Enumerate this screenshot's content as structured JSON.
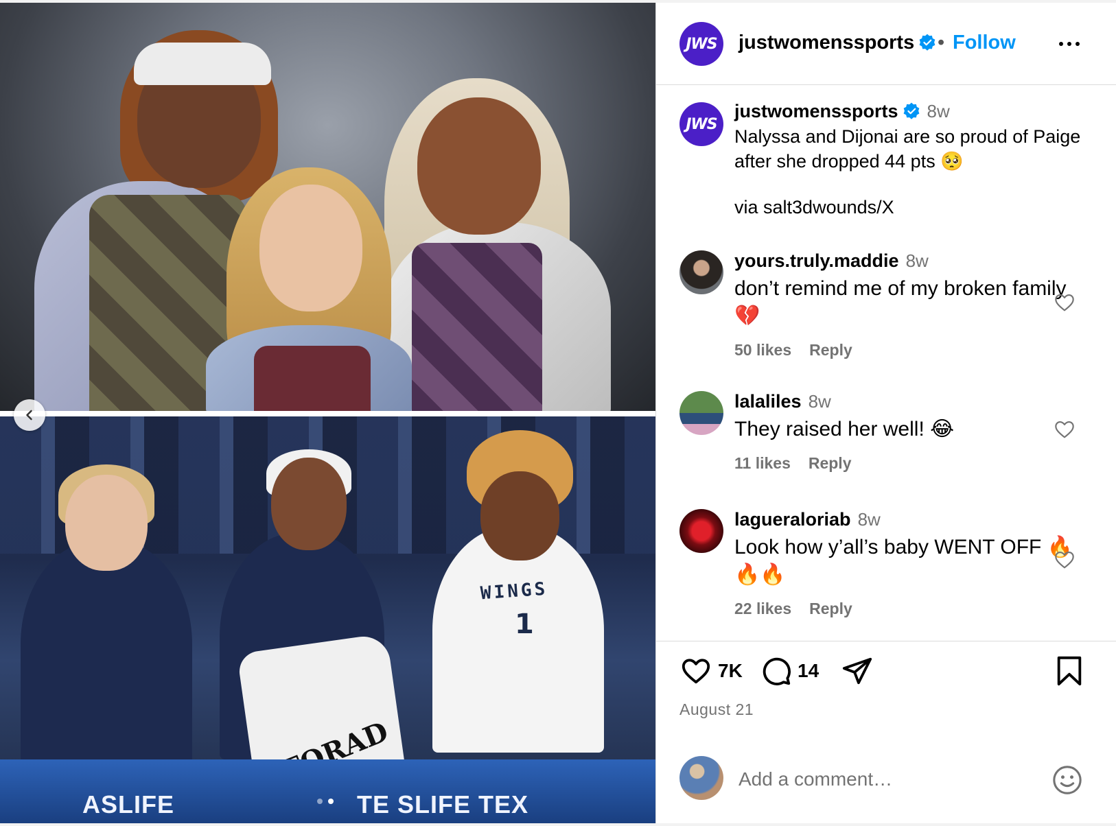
{
  "post": {
    "header": {
      "avatar_text": "JWS",
      "username": "justwomenssports",
      "separator": "•",
      "follow_label": "Follow"
    },
    "caption": {
      "avatar_text": "JWS",
      "username": "justwomenssports",
      "time": "8w",
      "text": "Nalyssa and Dijonai are so proud of Paige after she dropped 44 pts 🥺",
      "via": "via salt3dwounds/X"
    },
    "comments": [
      {
        "username": "yours.truly.maddie",
        "time": "8w",
        "text": "don’t remind me of my broken family 💔",
        "likes": "50 likes",
        "reply": "Reply"
      },
      {
        "username": "lalaliles",
        "time": "8w",
        "text": "They raised her well! 😂",
        "likes": "11 likes",
        "reply": "Reply"
      },
      {
        "username": "lagueraloriab",
        "time": "8w",
        "text": "Look how y’all’s baby WENT OFF 🔥🔥🔥",
        "likes": "22 likes",
        "reply": "Reply"
      }
    ],
    "actions": {
      "like_count": "7K",
      "comment_count": "14"
    },
    "date": "August 21",
    "add_comment": {
      "placeholder": "Add a comment…"
    },
    "media": {
      "towel_text": "ATORAD",
      "jersey_text": "WINGS",
      "jersey_number": "1",
      "sign_left": "ASLIFE",
      "sign_right": "TE SLIFE TEX",
      "carousel_dots": 2,
      "active_dot": 1
    }
  },
  "colors": {
    "brand_avatar": "#4b1fc7",
    "follow_blue": "#0095f6",
    "verified_blue": "#0095f6",
    "meta_gray": "#737373"
  },
  "icons": {
    "prev": "chevron-left-icon",
    "more": "more-horizontal-icon",
    "verified": "verified-badge-icon",
    "like": "heart-icon",
    "comment": "comment-bubble-icon",
    "share": "send-plane-icon",
    "save": "bookmark-icon",
    "emoji": "emoji-smile-icon"
  }
}
